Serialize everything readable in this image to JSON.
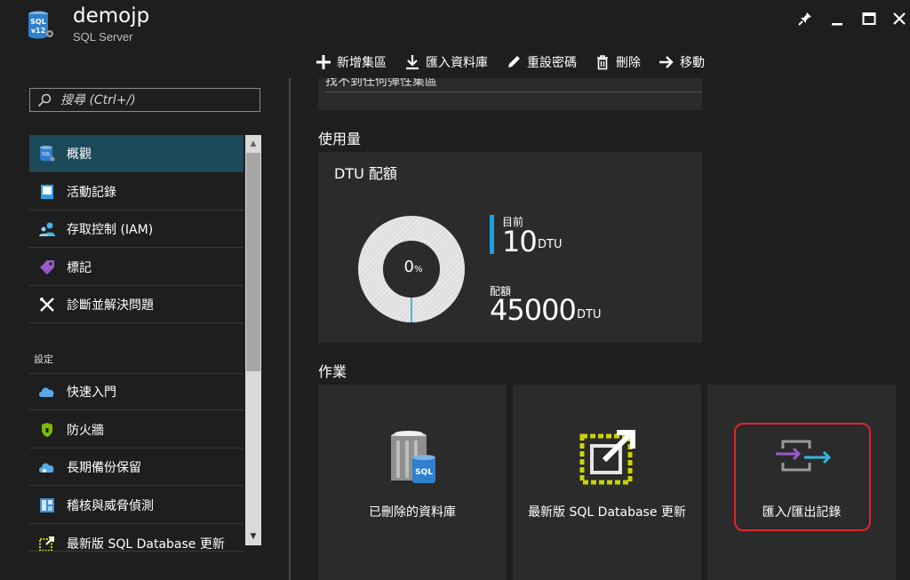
{
  "header": {
    "title": "demojp",
    "subtitle": "SQL Server",
    "app_icon_text": "SQL v12"
  },
  "toolbar": {
    "items": [
      {
        "label": "新增集區",
        "icon": "plus-icon"
      },
      {
        "label": "匯入資料庫",
        "icon": "download-icon"
      },
      {
        "label": "重設密碼",
        "icon": "pencil-icon"
      },
      {
        "label": "刪除",
        "icon": "trash-icon"
      },
      {
        "label": "移動",
        "icon": "arrow-right-icon"
      }
    ]
  },
  "window_controls": [
    "pin-icon",
    "minimize-icon",
    "maximize-icon",
    "close-icon"
  ],
  "search": {
    "placeholder": "搜尋 (Ctrl+/)"
  },
  "nav": {
    "items": [
      {
        "label": "概觀",
        "icon": "sql-icon",
        "active": true
      },
      {
        "label": "活動記錄",
        "icon": "log-icon"
      },
      {
        "label": "存取控制 (IAM)",
        "icon": "users-icon"
      },
      {
        "label": "標記",
        "icon": "tag-icon"
      },
      {
        "label": "診斷並解決問題",
        "icon": "tools-icon"
      }
    ],
    "section_label": "設定",
    "settings_items": [
      {
        "label": "快速入門",
        "icon": "cloud-icon"
      },
      {
        "label": "防火牆",
        "icon": "shield-icon"
      },
      {
        "label": "長期備份保留",
        "icon": "cloud-backup-icon"
      },
      {
        "label": "稽核與威脅偵測",
        "icon": "audit-icon"
      },
      {
        "label": "最新版 SQL Database 更新",
        "icon": "update-icon"
      }
    ]
  },
  "main": {
    "clipped_text": "找不到任何彈性集區",
    "usage": {
      "section_title": "使用量",
      "tile_title": "DTU 配額",
      "percent": "0",
      "percent_unit": "%",
      "current_label": "目前",
      "current_value": "10",
      "current_unit": "DTU",
      "quota_label": "配額",
      "quota_value": "45000",
      "quota_unit": "DTU",
      "fraction": 0.0002
    },
    "operations": {
      "section_title": "作業",
      "tiles": [
        {
          "label": "已刪除的資料庫",
          "icon": "deleted-db-icon"
        },
        {
          "label": "最新版 SQL Database 更新",
          "icon": "upgrade-icon"
        },
        {
          "label": "匯入/匯出記錄",
          "icon": "import-export-icon"
        }
      ]
    }
  },
  "colors": {
    "accent": "#1aa0e6",
    "active_nav": "#1d4a5a",
    "highlight": "#e0242c",
    "tile_bg": "#2b2b2b"
  }
}
